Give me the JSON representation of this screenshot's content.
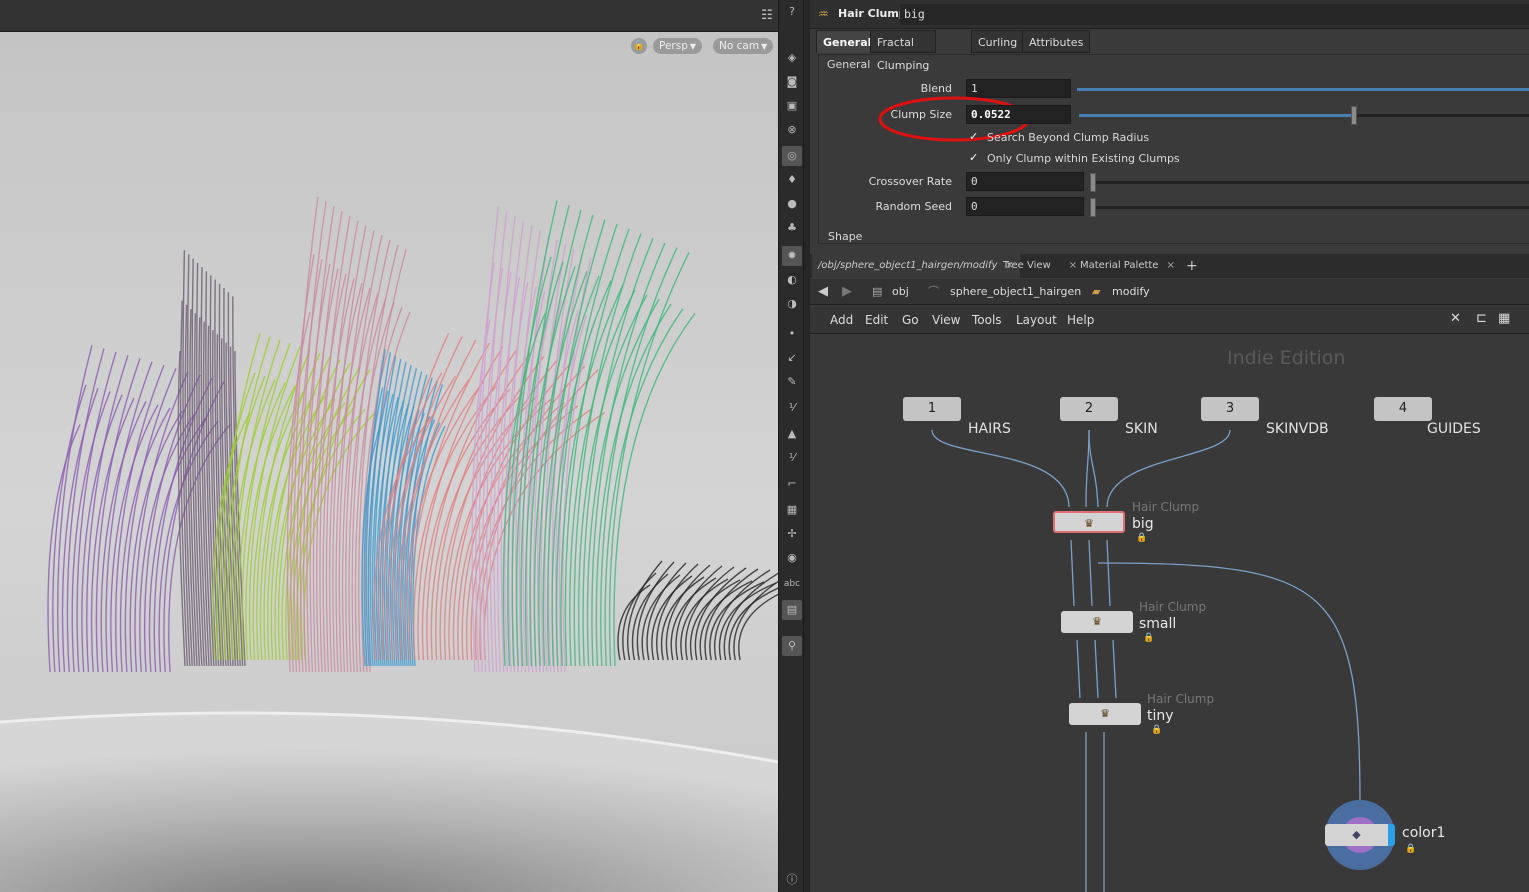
{
  "viewport": {
    "toolbar_icons": [
      "display-options-icon",
      "help-icon"
    ],
    "lock_label": "🔓",
    "persp_label": "Persp",
    "cam_label": "No cam",
    "tools": [
      "view-icon",
      "camera-icon",
      "lock-icon",
      "snap-icon",
      "select-icon",
      "light-icon",
      "bulb-icon",
      "lights-icon",
      "render-icon",
      "geo-icon",
      "dots-icon",
      "point-icon",
      "brush-icon",
      "pen-icon",
      "num12-icon",
      "paint-icon",
      "num12b-icon",
      "curve-icon",
      "grid-icon",
      "handle-icon",
      "ring-icon",
      "abc-icon",
      "image-icon",
      "pin-icon",
      "info-icon"
    ],
    "abc_label": "abc"
  },
  "params": {
    "node_type": "Hair Clump",
    "node_name": "big",
    "tabs": [
      "General",
      "Fractal Clumping",
      "Curling",
      "Attributes"
    ],
    "group_label": "General",
    "blend_label": "Blend",
    "blend_value": "1",
    "blend_fraction": 1.0,
    "clump_size_label": "Clump Size",
    "clump_size_value": "0.0522",
    "clump_size_fraction": 0.61,
    "search_beyond_label": "Search Beyond Clump Radius",
    "only_clump_label": "Only Clump within Existing Clumps",
    "crossover_label": "Crossover Rate",
    "crossover_value": "0",
    "random_seed_label": "Random Seed",
    "random_seed_value": "0",
    "shape_label": "Shape",
    "check_mark": "✓"
  },
  "network": {
    "tabs": [
      {
        "label": "/obj/sphere_object1_hairgen/modify",
        "close": "×"
      },
      {
        "label": "Tree View",
        "close": "×"
      },
      {
        "label": "Material Palette",
        "close": "×"
      }
    ],
    "add_tab": "+",
    "path": [
      "obj",
      "sphere_object1_hairgen",
      "modify"
    ],
    "menus": [
      "Add",
      "Edit",
      "Go",
      "View",
      "Tools",
      "Layout",
      "Help"
    ],
    "edition": "Indie Edition",
    "inputs": [
      {
        "num": "1",
        "label": "HAIRS"
      },
      {
        "num": "2",
        "label": "SKIN"
      },
      {
        "num": "3",
        "label": "SKINVDB"
      },
      {
        "num": "4",
        "label": "GUIDES"
      }
    ],
    "nodes": [
      {
        "type": "Hair Clump",
        "name": "big"
      },
      {
        "type": "Hair Clump",
        "name": "small"
      },
      {
        "type": "Hair Clump",
        "name": "tiny"
      },
      {
        "type": "",
        "name": "color1"
      }
    ]
  }
}
